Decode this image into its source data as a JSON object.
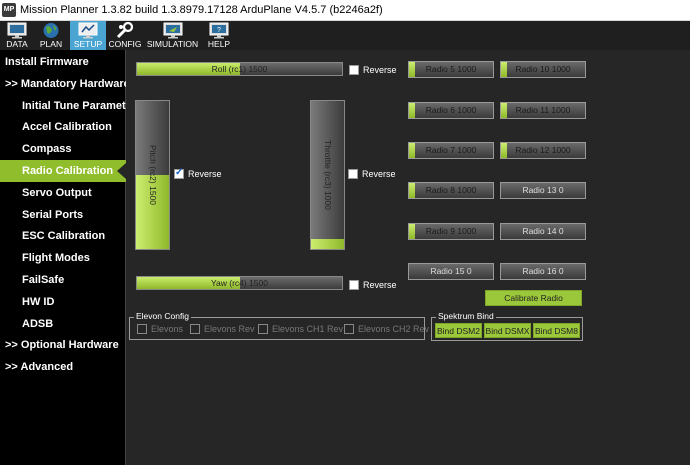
{
  "window": {
    "title": "Mission Planner 1.3.82 build 1.3.8979.17128 ArduPlane V4.5.7 (b2246a2f)",
    "app_icon_text": "MP"
  },
  "toolbar": {
    "buttons": [
      {
        "label": "DATA",
        "icon": "monitor-icon"
      },
      {
        "label": "PLAN",
        "icon": "globe-icon"
      },
      {
        "label": "SETUP",
        "icon": "setup-icon",
        "active": true
      },
      {
        "label": "CONFIG",
        "icon": "wrench-icon"
      },
      {
        "label": "SIMULATION",
        "icon": "simulation-icon"
      },
      {
        "label": "HELP",
        "icon": "help-monitor-icon"
      }
    ],
    "active_color": "#4aa5d2"
  },
  "sidebar": {
    "items": [
      {
        "label": "Install Firmware",
        "level": "top"
      },
      {
        "label": ">> Mandatory Hardware",
        "level": "top"
      },
      {
        "label": "Initial Tune Parameters",
        "level": "sub"
      },
      {
        "label": "Accel Calibration",
        "level": "sub"
      },
      {
        "label": "Compass",
        "level": "sub"
      },
      {
        "label": "Radio Calibration",
        "level": "sub",
        "selected": true
      },
      {
        "label": "Servo Output",
        "level": "sub"
      },
      {
        "label": "Serial Ports",
        "level": "sub"
      },
      {
        "label": "ESC Calibration",
        "level": "sub"
      },
      {
        "label": "Flight Modes",
        "level": "sub"
      },
      {
        "label": "FailSafe",
        "level": "sub"
      },
      {
        "label": "HW ID",
        "level": "sub"
      },
      {
        "label": "ADSB",
        "level": "sub"
      },
      {
        "label": ">> Optional Hardware",
        "level": "top"
      },
      {
        "label": ">> Advanced",
        "level": "top"
      }
    ],
    "selected_color": "#90bd2b"
  },
  "radio": {
    "roll": {
      "label": "Roll (rc1)  1500",
      "fill": 0.5,
      "reverse_label": "Reverse",
      "reverse_checked": false
    },
    "pitch": {
      "label": "Pitch (rc2)  1500",
      "fill": 0.5,
      "reverse_label": "Reverse",
      "reverse_checked": true
    },
    "throttle": {
      "label": "Throttle (rc3)  1000",
      "fill": 0.07,
      "reverse_label": "Reverse",
      "reverse_checked": false
    },
    "yaw": {
      "label": "Yaw (rc4)  1500",
      "fill": 0.5,
      "reverse_label": "Reverse",
      "reverse_checked": false
    },
    "channels": [
      {
        "label": "Radio 5  1000",
        "fill": 0.07
      },
      {
        "label": "Radio 10  1000",
        "fill": 0.07
      },
      {
        "label": "Radio 6  1000",
        "fill": 0.07
      },
      {
        "label": "Radio 11  1000",
        "fill": 0.07
      },
      {
        "label": "Radio 7  1000",
        "fill": 0.07
      },
      {
        "label": "Radio 12  1000",
        "fill": 0.07
      },
      {
        "label": "Radio 8  1000",
        "fill": 0.07
      },
      {
        "label": "Radio 13  0",
        "fill": 0
      },
      {
        "label": "Radio 9  1000",
        "fill": 0.07
      },
      {
        "label": "Radio 14  0",
        "fill": 0
      },
      {
        "label": "Radio 15  0",
        "fill": 0
      },
      {
        "label": "Radio 16  0",
        "fill": 0
      }
    ],
    "calibrate_label": "Calibrate Radio"
  },
  "elevon_config": {
    "title": "Elevon Config",
    "options": [
      "Elevons",
      "Elevons Rev",
      "Elevons CH1 Rev",
      "Elevons CH2 Rev"
    ]
  },
  "spektrum_bind": {
    "title": "Spektrum Bind",
    "buttons": [
      "Bind DSM2",
      "Bind DSMX",
      "Bind DSM8"
    ]
  }
}
